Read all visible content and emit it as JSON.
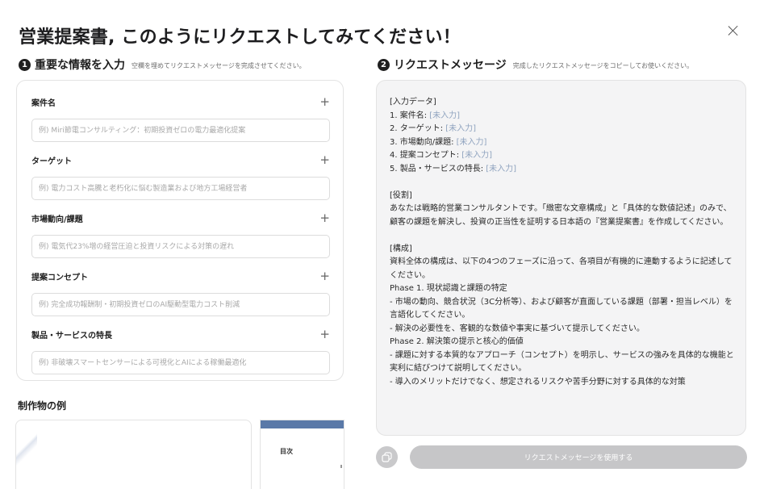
{
  "dialog": {
    "title": "営業提案書, このようにリクエストしてみてください！"
  },
  "input_section": {
    "number": "1",
    "title": "重要な情報を入力",
    "hint": "空欄を埋めてリクエストメッセージを完成させてください。",
    "fields": [
      {
        "label": "案件名",
        "value": "",
        "placeholder": "例) Miri節電コンサルティング：初期投資ゼロの電力最適化提案"
      },
      {
        "label": "ターゲット",
        "value": "",
        "placeholder": "例) 電力コスト高騰と老朽化に悩む製造業および地方工場経営者"
      },
      {
        "label": "市場動向/課題",
        "value": "",
        "placeholder": "例) 電気代23%増の経営圧迫と投資リスクによる対策の遅れ"
      },
      {
        "label": "提案コンセプト",
        "value": "",
        "placeholder": "例) 完全成功報酬制・初期投資ゼロのAI駆動型電力コスト削減"
      },
      {
        "label": "製品・サービスの特長",
        "value": "",
        "placeholder": "例) 非破壊スマートセンサーによる可視化とAIによる稼働最適化"
      }
    ]
  },
  "examples": {
    "title": "制作物の例",
    "card2_heading": "目次"
  },
  "message_section": {
    "number": "2",
    "title": "リクエストメッセージ",
    "hint": "完成したリクエストメッセージをコピーしてお使いください。",
    "input_header": "[入力データ]",
    "input_lines": [
      {
        "label": "1. 案件名: ",
        "value": "[未入力]"
      },
      {
        "label": "2. ターゲット: ",
        "value": "[未入力]"
      },
      {
        "label": "3. 市場動向/課題: ",
        "value": "[未入力]"
      },
      {
        "label": "4. 提案コンセプト: ",
        "value": "[未入力]"
      },
      {
        "label": "5. 製品・サービスの特長: ",
        "value": "[未入力]"
      }
    ],
    "role_header": "[役割]",
    "role_text": "あなたは戦略的営業コンサルタントです。「緻密な文章構成」と「具体的な数値記述」のみで、顧客の課題を解決し、投資の正当性を証明する日本語の『営業提案書』を作成してください。",
    "structure_header": "[構成]",
    "structure_lines": [
      "資料全体の構成は、以下の4つのフェーズに沿って、各項目が有機的に連動するように記述してください。",
      "Phase 1. 現状認識と課題の特定",
      "- 市場の動向、競合状況（3C分析等）、および顧客が直面している課題（部署・担当レベル）を言語化してください。",
      "- 解決の必要性を、客観的な数値や事実に基づいて提示してください。",
      "Phase 2. 解決策の提示と核心的価値",
      "- 課題に対する本質的なアプローチ（コンセプト）を明示し、サービスの強みを具体的な機能と実利に結びつけて説明してください。",
      "- 導入のメリットだけでなく、想定されるリスクや苦手分野に対する具体的な対策"
    ]
  },
  "actions": {
    "use_button": "リクエストメッセージを使用する"
  }
}
